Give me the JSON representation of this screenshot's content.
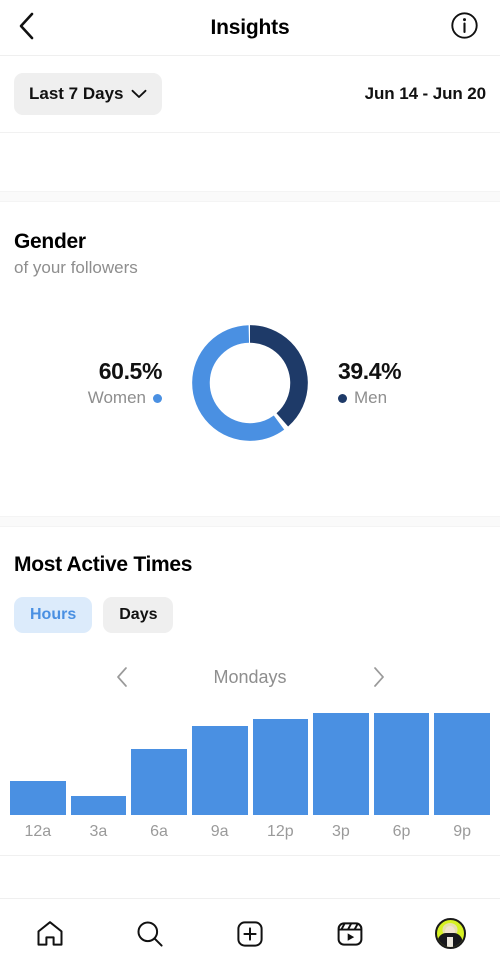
{
  "navbar": {
    "title": "Insights",
    "back_icon": "chevron-left-icon",
    "info_icon": "info-circle-icon"
  },
  "date_row": {
    "range_label": "Last 7 Days",
    "range_chevron_icon": "chevron-down-icon",
    "date_range": "Jun 14 - Jun 20"
  },
  "gender": {
    "title": "Gender",
    "subtitle": "of your followers",
    "women": {
      "pct": "60.5%",
      "label": "Women",
      "color": "#4a90e2"
    },
    "men": {
      "pct": "39.4%",
      "label": "Men",
      "color": "#1e3a68"
    }
  },
  "most_active": {
    "title": "Most Active Times",
    "tabs": [
      {
        "label": "Hours",
        "active": true
      },
      {
        "label": "Days",
        "active": false
      }
    ],
    "day_nav": {
      "prev_icon": "chevron-left-icon",
      "next_icon": "chevron-right-icon",
      "current": "Mondays"
    }
  },
  "tabbar": {
    "items": [
      {
        "name": "home-icon",
        "label": "Home"
      },
      {
        "name": "search-icon",
        "label": "Search"
      },
      {
        "name": "create-icon",
        "label": "Create"
      },
      {
        "name": "reels-icon",
        "label": "Reels"
      },
      {
        "name": "profile-avatar-icon",
        "label": "Profile"
      }
    ]
  },
  "chart_data": [
    {
      "type": "pie",
      "title": "Gender",
      "subtitle": "of your followers",
      "labels": [
        "Women",
        "Men"
      ],
      "values": [
        60.5,
        39.4
      ],
      "value_labels": [
        "60.5%",
        "39.4%"
      ],
      "colors": [
        "#4a90e2",
        "#1e3a68"
      ],
      "donut": true,
      "start_angle_deg": 0,
      "legend": "sides"
    },
    {
      "type": "bar",
      "title": "Most Active Times",
      "subtitle": "Mondays",
      "categories": [
        "12a",
        "3a",
        "6a",
        "9a",
        "12p",
        "3p",
        "6p",
        "9p"
      ],
      "values": [
        33,
        19,
        65,
        87,
        94,
        100,
        100,
        100
      ],
      "xlabel": "",
      "ylabel": "",
      "ylim": [
        0,
        100
      ],
      "grid": false,
      "color": "#4a90e2",
      "legend": "none"
    }
  ]
}
